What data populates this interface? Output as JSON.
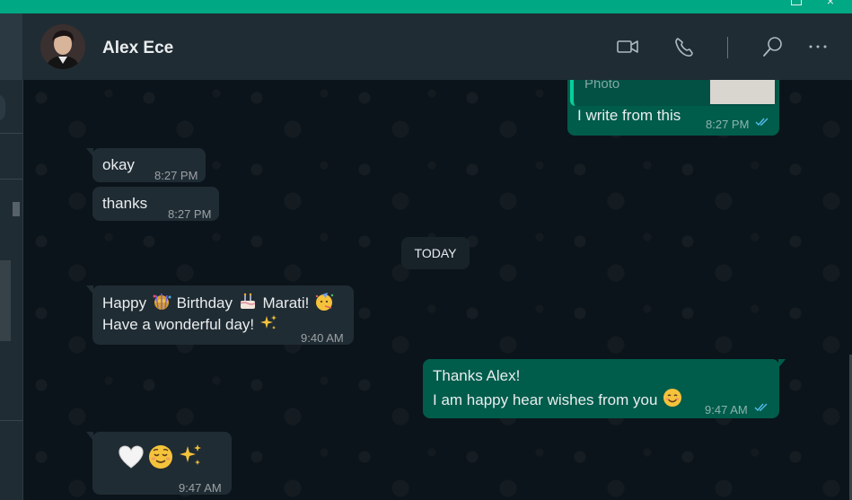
{
  "header": {
    "contact_name": "Alex Ece",
    "icons": [
      "video-call-icon",
      "voice-call-icon",
      "search-icon",
      "menu-icon"
    ]
  },
  "chat": {
    "partial_top": {
      "attachment_label": "Photo",
      "text": "I write from this",
      "time": "8:27 PM",
      "status": "read"
    },
    "messages": [
      {
        "direction": "in",
        "text": "okay",
        "time": "8:27 PM"
      },
      {
        "direction": "in",
        "text": "thanks",
        "time": "8:27 PM"
      },
      {
        "type": "date",
        "label": "TODAY"
      },
      {
        "direction": "in",
        "line1_parts": [
          "Happy",
          "Birthday",
          "Marati!"
        ],
        "line2": "Have a wonderful day!",
        "time": "9:40 AM"
      },
      {
        "direction": "out",
        "line1": "Thanks Alex!",
        "line2": "I am happy hear wishes from you",
        "time": "9:47 AM",
        "status": "read"
      },
      {
        "direction": "in",
        "emoji_only": true,
        "emojis": [
          "white-heart",
          "relieved-face",
          "sparkles"
        ],
        "time": "9:47 AM"
      }
    ]
  },
  "colors": {
    "accent": "#00a884",
    "header_bg": "#202c33",
    "chat_bg": "#0b141a",
    "incoming_bubble": "#202c33",
    "outgoing_bubble": "#005c4b",
    "read_ticks": "#53bdeb"
  }
}
